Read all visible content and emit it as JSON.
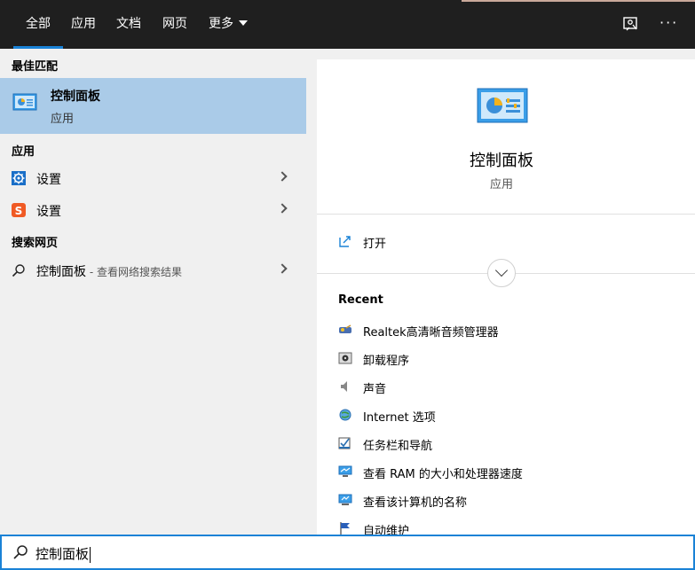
{
  "tabs": [
    {
      "label": "全部",
      "active": true
    },
    {
      "label": "应用"
    },
    {
      "label": "文档"
    },
    {
      "label": "网页"
    },
    {
      "label": "更多"
    }
  ],
  "topbar": {
    "more_icon": "ellipsis-icon",
    "feedback_icon": "feedback-icon"
  },
  "left": {
    "best_match_title": "最佳匹配",
    "best_match": {
      "title": "控制面板",
      "subtitle": "应用",
      "icon": "control-panel-icon"
    },
    "apps_title": "应用",
    "apps": [
      {
        "label": "设置",
        "icon": "settings-gear-icon"
      },
      {
        "label": "设置",
        "icon": "sogou-settings-icon"
      }
    ],
    "web_title": "搜索网页",
    "web_result": {
      "label": "控制面板",
      "hint": " - 查看网络搜索结果",
      "icon": "search-icon"
    }
  },
  "right": {
    "title": "控制面板",
    "subtitle": "应用",
    "open_label": "打开",
    "recent_title": "Recent",
    "recent": [
      {
        "label": "Realtek高清晰音频管理器",
        "icon": "realtek-audio-icon"
      },
      {
        "label": "卸载程序",
        "icon": "uninstall-program-icon"
      },
      {
        "label": "声音",
        "icon": "speaker-icon"
      },
      {
        "label": "Internet 选项",
        "icon": "internet-options-icon"
      },
      {
        "label": "任务栏和导航",
        "icon": "taskbar-icon"
      },
      {
        "label": "查看 RAM 的大小和处理器速度",
        "icon": "system-monitor-icon"
      },
      {
        "label": "查看该计算机的名称",
        "icon": "computer-name-icon"
      },
      {
        "label": "自动维护",
        "icon": "maintenance-flag-icon"
      }
    ]
  },
  "search": {
    "value": "控制面板"
  },
  "colors": {
    "accent": "#1a82d6",
    "selected": "#aacbe8",
    "topbar": "#1f1f1f"
  }
}
